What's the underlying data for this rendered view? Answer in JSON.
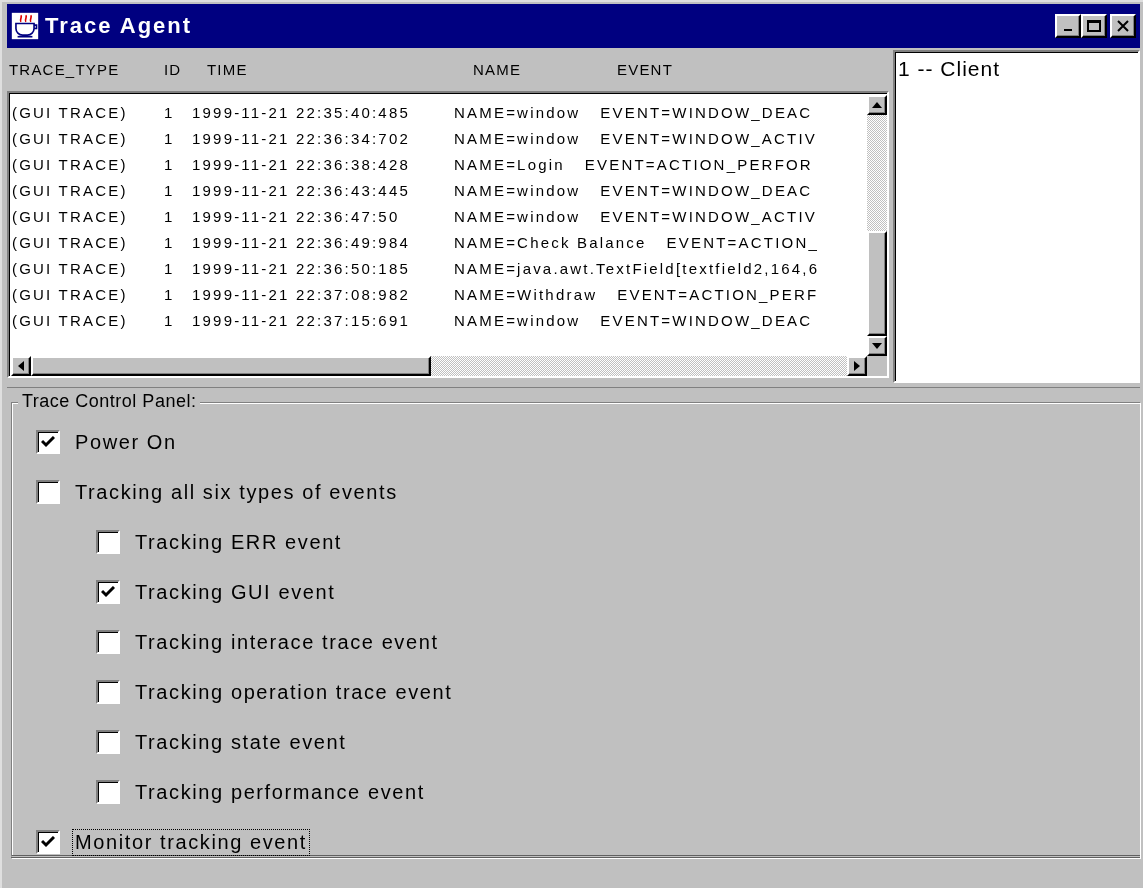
{
  "window": {
    "title": "Trace Agent"
  },
  "table": {
    "columns": [
      "TRACE_TYPE",
      "ID",
      "TIME",
      "NAME",
      "EVENT"
    ],
    "rows": [
      {
        "trace_type": "(GUI TRACE)",
        "id": "1",
        "time": "1999-11-21 22:35:40:485",
        "name": "NAME=window",
        "event": "EVENT=WINDOW_DEAC"
      },
      {
        "trace_type": "(GUI TRACE)",
        "id": "1",
        "time": "1999-11-21 22:36:34:702",
        "name": "NAME=window",
        "event": "EVENT=WINDOW_ACTIV"
      },
      {
        "trace_type": "(GUI TRACE)",
        "id": "1",
        "time": "1999-11-21 22:36:38:428",
        "name": "NAME=Login",
        "event": "EVENT=ACTION_PERFOR"
      },
      {
        "trace_type": "(GUI TRACE)",
        "id": "1",
        "time": "1999-11-21 22:36:43:445",
        "name": "NAME=window",
        "event": "EVENT=WINDOW_DEAC"
      },
      {
        "trace_type": "(GUI TRACE)",
        "id": "1",
        "time": "1999-11-21 22:36:47:50",
        "name": "NAME=window",
        "event": "EVENT=WINDOW_ACTIV"
      },
      {
        "trace_type": "(GUI TRACE)",
        "id": "1",
        "time": "1999-11-21 22:36:49:984",
        "name": "NAME=Check Balance",
        "event": "EVENT=ACTION_"
      },
      {
        "trace_type": "(GUI TRACE)",
        "id": "1",
        "time": "1999-11-21 22:36:50:185",
        "name": "NAME=java.awt.TextField[textfield2,164,6"
      },
      {
        "trace_type": "(GUI TRACE)",
        "id": "1",
        "time": "1999-11-21 22:37:08:982",
        "name": "NAME=Withdraw",
        "event": "EVENT=ACTION_PERF"
      },
      {
        "trace_type": "(GUI TRACE)",
        "id": "1",
        "time": "1999-11-21 22:37:15:691",
        "name": "NAME=window",
        "event": "EVENT=WINDOW_DEAC"
      }
    ]
  },
  "client_list": {
    "items": [
      {
        "label": "1 -- Client",
        "selected": false
      }
    ]
  },
  "control_panel": {
    "title": "Trace Control Panel:",
    "options": [
      {
        "label": "Power On",
        "checked": true,
        "focused": false
      },
      {
        "label": "Tracking all six types of events",
        "checked": false,
        "focused": false,
        "children": [
          {
            "label": "Tracking ERR event",
            "checked": false,
            "focused": false
          },
          {
            "label": "Tracking GUI event",
            "checked": true,
            "focused": false
          },
          {
            "label": "Tracking interace trace event",
            "checked": false,
            "focused": false
          },
          {
            "label": "Tracking operation trace event",
            "checked": false,
            "focused": false
          },
          {
            "label": "Tracking state event",
            "checked": false,
            "focused": false
          },
          {
            "label": "Tracking performance event",
            "checked": false,
            "focused": false
          }
        ]
      },
      {
        "label": "Monitor tracking event",
        "checked": true,
        "focused": true
      }
    ]
  }
}
